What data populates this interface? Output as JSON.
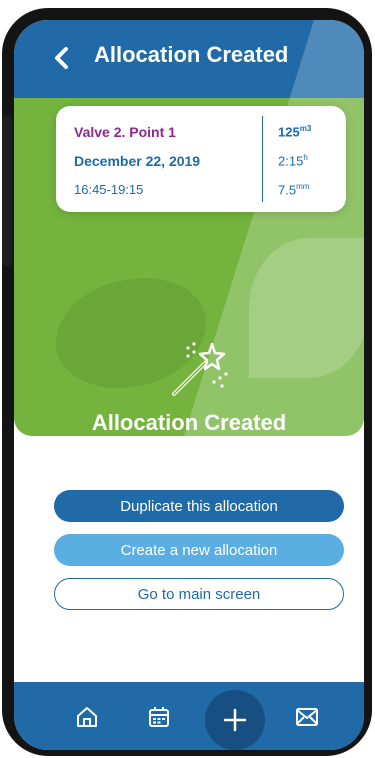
{
  "header": {
    "title": "Allocation Created",
    "back_icon": "chevron-left-icon"
  },
  "card": {
    "location": "Valve 2. Point 1",
    "date": "December 22, 2019",
    "time_range": "16:45-19:15",
    "volume_value": "125",
    "volume_unit": "m3",
    "duration_value": "2:15",
    "duration_unit": "h",
    "depth_value": "7.5",
    "depth_unit": "mm"
  },
  "hero": {
    "icon": "magic-wand-icon",
    "title": "Allocation Created"
  },
  "actions": {
    "duplicate_label": "Duplicate this allocation",
    "new_label": "Create a new allocation",
    "main_label": "Go to main screen"
  },
  "nav": {
    "icons": [
      "home-icon",
      "calendar-icon",
      "plus-icon",
      "mail-icon"
    ]
  },
  "colors": {
    "primary_blue": "#1f6aa7",
    "light_blue": "#5aaee1",
    "green": "#73b33e",
    "purple": "#8b2a8b"
  }
}
